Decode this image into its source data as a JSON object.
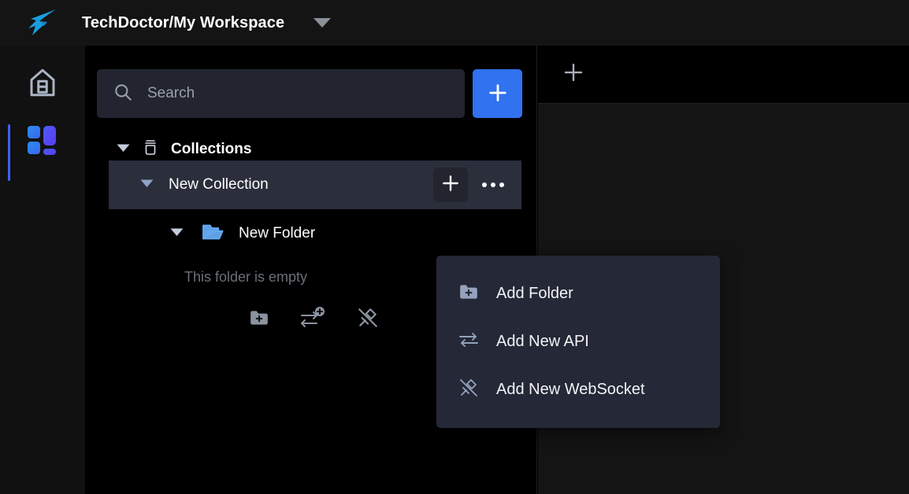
{
  "app": {
    "logo_icon": "hummingbird-logo",
    "accent_blue": "#3072f0",
    "logo_blue": "#1a9de0",
    "sidebar_bg": "#000000",
    "panel_bg": "#141414",
    "highlight_bg": "#2b2e3b",
    "menu_bg": "#242837"
  },
  "header": {
    "workspace": "TechDoctor/My Workspace",
    "caret_icon": "chevron-down-icon"
  },
  "rail": {
    "items": [
      {
        "name": "home",
        "icon": "home-icon",
        "active": false
      },
      {
        "name": "collections",
        "icon": "collections-grid-icon",
        "active": true
      }
    ]
  },
  "sidebar": {
    "search": {
      "placeholder": "Search",
      "value": "",
      "icon": "search-icon"
    },
    "add_button": {
      "label": "+",
      "icon": "plus-icon"
    },
    "section": {
      "title": "Collections",
      "icon": "collection-jar-icon",
      "expanded": true,
      "caret_icon": "caret-down-icon"
    },
    "collection": {
      "name": "New Collection",
      "expanded": true,
      "caret_icon": "caret-down-icon",
      "add_icon": "plus-icon",
      "more_icon": "more-horizontal-icon"
    },
    "folder": {
      "name": "New Folder",
      "expanded": true,
      "caret_icon": "caret-down-icon",
      "icon": "folder-open-icon",
      "empty_message": "This folder is empty",
      "empty_actions": [
        {
          "name": "add-folder",
          "icon": "folder-plus-icon"
        },
        {
          "name": "add-new-api",
          "icon": "exchange-plus-icon"
        },
        {
          "name": "add-new-websocket",
          "icon": "websocket-icon"
        }
      ]
    }
  },
  "main": {
    "new_tab": {
      "icon": "plus-icon",
      "label": "+"
    }
  },
  "context_menu": {
    "visible": true,
    "items": [
      {
        "label": "Add Folder",
        "icon": "folder-plus-icon"
      },
      {
        "label": "Add New API",
        "icon": "exchange-icon"
      },
      {
        "label": "Add New WebSocket",
        "icon": "websocket-icon"
      }
    ]
  }
}
